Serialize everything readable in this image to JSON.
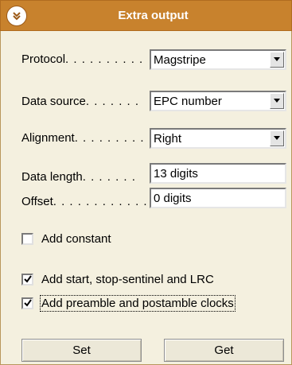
{
  "header": {
    "title": "Extra output",
    "collapse_icon": "double-chevron-down-icon"
  },
  "fields": {
    "protocol": {
      "label": "Protocol",
      "dots": ". . . . . . . . . .",
      "value": "Magstripe"
    },
    "data_source": {
      "label": "Data source",
      "dots": ". . . . . . .",
      "value": "EPC number"
    },
    "alignment": {
      "label": "Alignment",
      "dots": ". . . . . . . . .",
      "value": "Right"
    },
    "data_length": {
      "label": "Data length",
      "dots": ". . . . . . .",
      "value": "13 digits"
    },
    "offset": {
      "label": "Offset",
      "dots": ". . . . . . . . . . . .",
      "value": "0 digits"
    }
  },
  "checkboxes": {
    "add_constant": {
      "label": "Add constant",
      "checked": false
    },
    "add_sentinel_lrc": {
      "label": "Add start, stop-sentinel and LRC",
      "checked": true
    },
    "add_preamble": {
      "label": "Add preamble and postamble clocks",
      "checked": true
    }
  },
  "buttons": {
    "set": "Set",
    "get": "Get"
  },
  "colors": {
    "title_bar": "#c8822d",
    "panel_bg": "#f4f0df",
    "button_bg": "#ece8d8"
  }
}
